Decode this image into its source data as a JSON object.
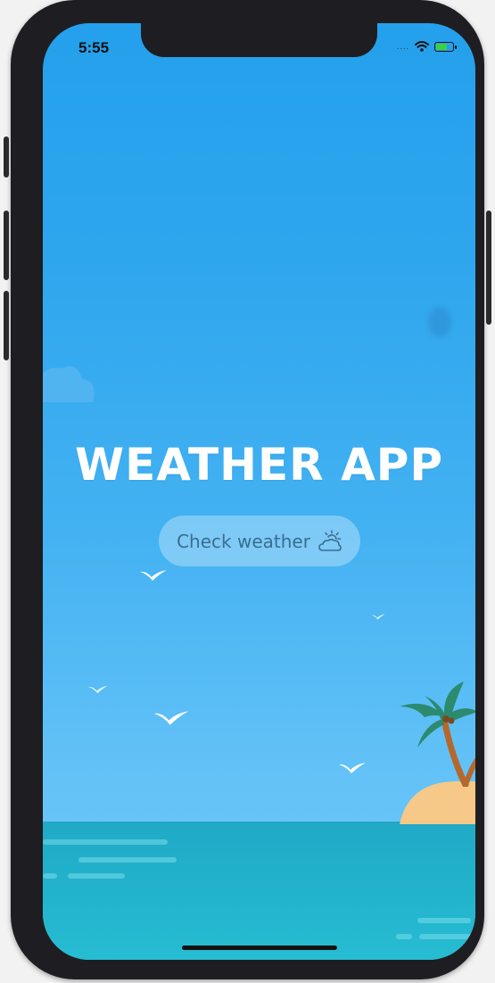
{
  "status_bar": {
    "time": "5:55",
    "signal": "....",
    "wifi_icon": "wifi-icon",
    "battery_icon": "battery-charging-icon"
  },
  "app": {
    "title": "WEATHER APP",
    "check_button_label": "Check weather",
    "check_button_icon": "sun-behind-cloud-icon"
  },
  "colors": {
    "sky_top": "#24a0ec",
    "sky_bottom": "#73c8f7",
    "sea": "#22b3cc",
    "button_text": "#3a6d92",
    "sand": "#f7c989",
    "palm_leaf": "#2c8a6e"
  }
}
